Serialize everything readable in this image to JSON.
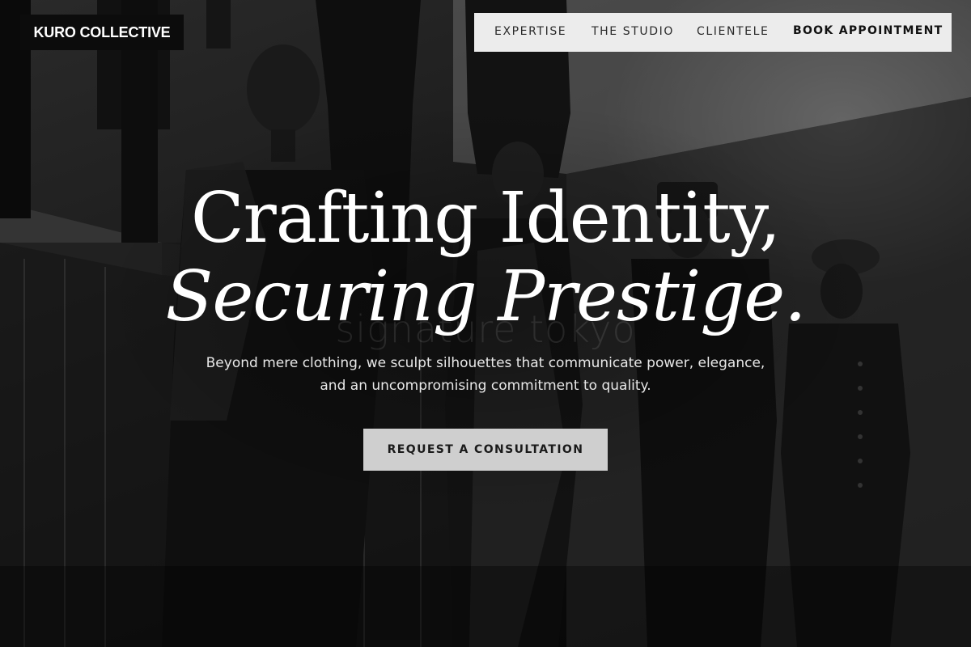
{
  "brand": {
    "name": "KURO COLLECTIVE"
  },
  "nav": {
    "items": [
      {
        "label": "EXPERTISE"
      },
      {
        "label": "THE STUDIO"
      },
      {
        "label": "CLIENTELE"
      }
    ],
    "cta_label": "BOOK APPOINTMENT"
  },
  "hero": {
    "headline_line1": "Crafting Identity,",
    "headline_line2": "Securing Prestige.",
    "watermark": "signature tokyo",
    "subtext": "Beyond mere clothing, we sculpt silhouettes that communicate power, elegance, and an uncompromising commitment to quality.",
    "cta_label": "REQUEST A CONSULTATION"
  },
  "colors": {
    "nav_background": "#ececec",
    "brand_background": "#0c0c0c",
    "cta_background": "#cfcfcf",
    "text_light": "#ffffff"
  }
}
